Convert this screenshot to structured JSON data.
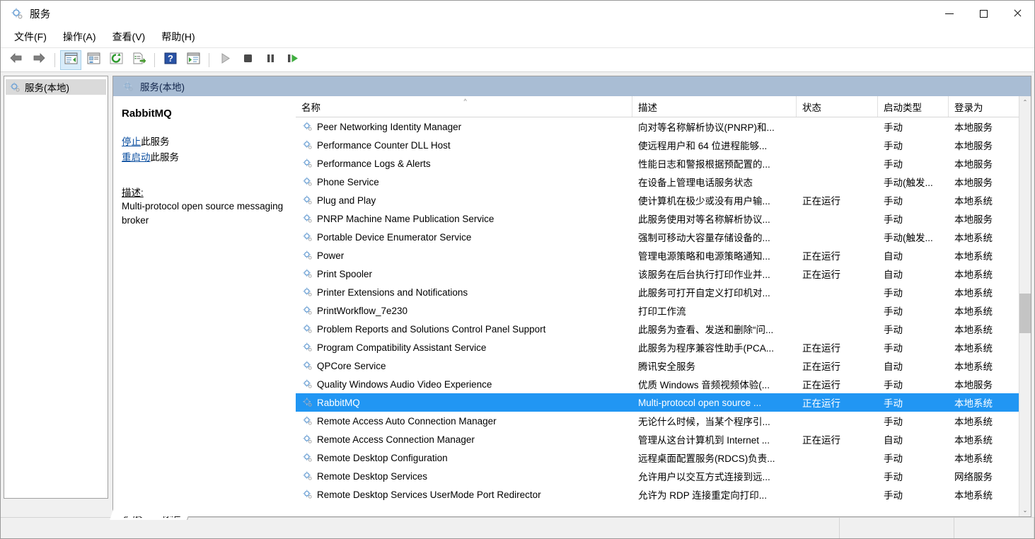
{
  "window": {
    "title": "服务",
    "icon": "services-gear-icon",
    "controls": {
      "minimize": "最小化",
      "maximize": "最大化",
      "close": "关闭"
    }
  },
  "menubar": {
    "items": [
      {
        "label": "文件(F)",
        "name": "menu-file"
      },
      {
        "label": "操作(A)",
        "name": "menu-action"
      },
      {
        "label": "查看(V)",
        "name": "menu-view"
      },
      {
        "label": "帮助(H)",
        "name": "menu-help"
      }
    ]
  },
  "toolbar": {
    "buttons": [
      {
        "icon": "back-arrow-icon",
        "name": "toolbar-back",
        "selected": false
      },
      {
        "icon": "forward-arrow-icon",
        "name": "toolbar-forward",
        "selected": false
      },
      {
        "icon": "show-hide-console-tree-icon",
        "name": "toolbar-show-tree",
        "selected": true
      },
      {
        "icon": "properties-icon",
        "name": "toolbar-properties",
        "selected": false
      },
      {
        "icon": "refresh-icon",
        "name": "toolbar-refresh",
        "selected": false
      },
      {
        "icon": "export-list-icon",
        "name": "toolbar-export-list",
        "selected": false
      },
      {
        "icon": "help-icon",
        "name": "toolbar-help",
        "selected": false
      },
      {
        "icon": "show-action-pane-icon",
        "name": "toolbar-action-pane",
        "selected": false
      },
      {
        "icon": "start-service-icon",
        "name": "toolbar-start-service",
        "selected": false
      },
      {
        "icon": "stop-service-icon",
        "name": "toolbar-stop-service",
        "selected": false
      },
      {
        "icon": "pause-service-icon",
        "name": "toolbar-pause-service",
        "selected": false
      },
      {
        "icon": "restart-service-icon",
        "name": "toolbar-restart-service",
        "selected": false
      }
    ]
  },
  "sidebar": {
    "items": [
      {
        "label": "服务(本地)",
        "name": "tree-item-services-local",
        "icon": "services-gear-icon",
        "selected": true
      }
    ]
  },
  "banner": {
    "label": "服务(本地)",
    "icon": "services-gear-icon"
  },
  "details": {
    "service_name": "RabbitMQ",
    "stop_link": "停止",
    "stop_suffix": "此服务",
    "restart_link": "重启动",
    "restart_suffix": "此服务",
    "description_label": "描述:",
    "description_text": "Multi-protocol open source messaging broker"
  },
  "list": {
    "columns": [
      {
        "label": "名称",
        "name": "column-header-name",
        "sorted": "asc"
      },
      {
        "label": "描述",
        "name": "column-header-description",
        "sorted": ""
      },
      {
        "label": "状态",
        "name": "column-header-status",
        "sorted": ""
      },
      {
        "label": "启动类型",
        "name": "column-header-startup-type",
        "sorted": ""
      },
      {
        "label": "登录为",
        "name": "column-header-log-on-as",
        "sorted": ""
      }
    ],
    "sort_indicator": "^",
    "rows": [
      {
        "name": "Peer Networking Identity Manager",
        "description": "向对等名称解析协议(PNRP)和...",
        "status": "",
        "startup": "手动",
        "logon": "本地服务",
        "selected": false
      },
      {
        "name": "Performance Counter DLL Host",
        "description": "使远程用户和 64 位进程能够...",
        "status": "",
        "startup": "手动",
        "logon": "本地服务",
        "selected": false
      },
      {
        "name": "Performance Logs & Alerts",
        "description": "性能日志和警报根据预配置的...",
        "status": "",
        "startup": "手动",
        "logon": "本地服务",
        "selected": false
      },
      {
        "name": "Phone Service",
        "description": "在设备上管理电话服务状态",
        "status": "",
        "startup": "手动(触发...",
        "logon": "本地服务",
        "selected": false
      },
      {
        "name": "Plug and Play",
        "description": "使计算机在极少或没有用户输...",
        "status": "正在运行",
        "startup": "手动",
        "logon": "本地系统",
        "selected": false
      },
      {
        "name": "PNRP Machine Name Publication Service",
        "description": "此服务使用对等名称解析协议...",
        "status": "",
        "startup": "手动",
        "logon": "本地服务",
        "selected": false
      },
      {
        "name": "Portable Device Enumerator Service",
        "description": "强制可移动大容量存储设备的...",
        "status": "",
        "startup": "手动(触发...",
        "logon": "本地系统",
        "selected": false
      },
      {
        "name": "Power",
        "description": "管理电源策略和电源策略通知...",
        "status": "正在运行",
        "startup": "自动",
        "logon": "本地系统",
        "selected": false
      },
      {
        "name": "Print Spooler",
        "description": "该服务在后台执行打印作业并...",
        "status": "正在运行",
        "startup": "自动",
        "logon": "本地系统",
        "selected": false
      },
      {
        "name": "Printer Extensions and Notifications",
        "description": "此服务可打开自定义打印机对...",
        "status": "",
        "startup": "手动",
        "logon": "本地系统",
        "selected": false
      },
      {
        "name": "PrintWorkflow_7e230",
        "description": "打印工作流",
        "status": "",
        "startup": "手动",
        "logon": "本地系统",
        "selected": false
      },
      {
        "name": "Problem Reports and Solutions Control Panel Support",
        "description": "此服务为查看、发送和删除“问...",
        "status": "",
        "startup": "手动",
        "logon": "本地系统",
        "selected": false
      },
      {
        "name": "Program Compatibility Assistant Service",
        "description": "此服务为程序兼容性助手(PCA...",
        "status": "正在运行",
        "startup": "手动",
        "logon": "本地系统",
        "selected": false
      },
      {
        "name": "QPCore Service",
        "description": "腾讯安全服务",
        "status": "正在运行",
        "startup": "自动",
        "logon": "本地系统",
        "selected": false
      },
      {
        "name": "Quality Windows Audio Video Experience",
        "description": "优质 Windows 音频视频体验(...",
        "status": "正在运行",
        "startup": "手动",
        "logon": "本地服务",
        "selected": false
      },
      {
        "name": "RabbitMQ",
        "description": "Multi-protocol open source ...",
        "status": "正在运行",
        "startup": "手动",
        "logon": "本地系统",
        "selected": true
      },
      {
        "name": "Remote Access Auto Connection Manager",
        "description": "无论什么时候，当某个程序引...",
        "status": "",
        "startup": "手动",
        "logon": "本地系统",
        "selected": false
      },
      {
        "name": "Remote Access Connection Manager",
        "description": "管理从这台计算机到 Internet ...",
        "status": "正在运行",
        "startup": "自动",
        "logon": "本地系统",
        "selected": false
      },
      {
        "name": "Remote Desktop Configuration",
        "description": "远程桌面配置服务(RDCS)负责...",
        "status": "",
        "startup": "手动",
        "logon": "本地系统",
        "selected": false
      },
      {
        "name": "Remote Desktop Services",
        "description": "允许用户以交互方式连接到远...",
        "status": "",
        "startup": "手动",
        "logon": "网络服务",
        "selected": false
      },
      {
        "name": "Remote Desktop Services UserMode Port Redirector",
        "description": "允许为 RDP 连接重定向打印...",
        "status": "",
        "startup": "手动",
        "logon": "本地系统",
        "selected": false
      }
    ]
  },
  "tabs": [
    {
      "label": "扩展",
      "name": "tab-extended",
      "active": false
    },
    {
      "label": "标准",
      "name": "tab-standard",
      "active": true
    }
  ],
  "scrollbar": {
    "up_arrow": "⌃",
    "down_arrow": "⌄"
  },
  "colors": {
    "selection": "#2196f3",
    "banner": "#a9bdd4",
    "link": "#0c4fa0",
    "chrome": "#f0f0f0"
  }
}
